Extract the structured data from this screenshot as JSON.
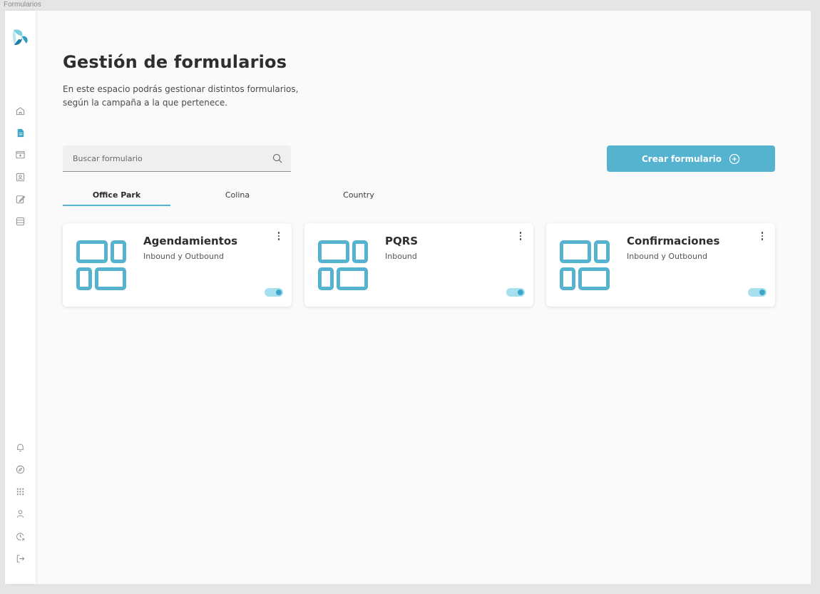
{
  "frame_label": "Formularios",
  "sidebar": {
    "logo": "app-logo",
    "top_items": [
      {
        "name": "home-icon",
        "active": false
      },
      {
        "name": "forms-icon",
        "active": true
      },
      {
        "name": "folder-icon",
        "active": false
      },
      {
        "name": "contacts-icon",
        "active": false
      },
      {
        "name": "edit-icon",
        "active": false
      },
      {
        "name": "database-icon",
        "active": false
      }
    ],
    "bottom_items": [
      {
        "name": "bell-icon"
      },
      {
        "name": "compass-icon"
      },
      {
        "name": "apps-grid-icon"
      },
      {
        "name": "user-icon"
      },
      {
        "name": "clock-cancel-icon"
      },
      {
        "name": "logout-icon"
      }
    ]
  },
  "header": {
    "title": "Gestión de formularios",
    "description_line1": "En este espacio podrás gestionar distintos formularios,",
    "description_line2": "según la campaña a la que pertenece."
  },
  "search": {
    "placeholder": "Buscar formulario",
    "value": ""
  },
  "create_button": {
    "label": "Crear formulario"
  },
  "tabs": [
    {
      "label": "Office Park",
      "active": true
    },
    {
      "label": "Colina",
      "active": false
    },
    {
      "label": "Country",
      "active": false
    }
  ],
  "cards": [
    {
      "title": "Agendamientos",
      "subtitle": "Inbound y Outbound",
      "enabled": true
    },
    {
      "title": "PQRS",
      "subtitle": "Inbound",
      "enabled": true
    },
    {
      "title": "Confirmaciones",
      "subtitle": "Inbound y Outbound",
      "enabled": true
    }
  ],
  "colors": {
    "accent": "#55b3d0",
    "icon_stroke": "#8a8a8a",
    "active_icon": "#3ea6c8",
    "toggle_track": "#a6e0ee",
    "toggle_knob": "#3ea6c8"
  }
}
